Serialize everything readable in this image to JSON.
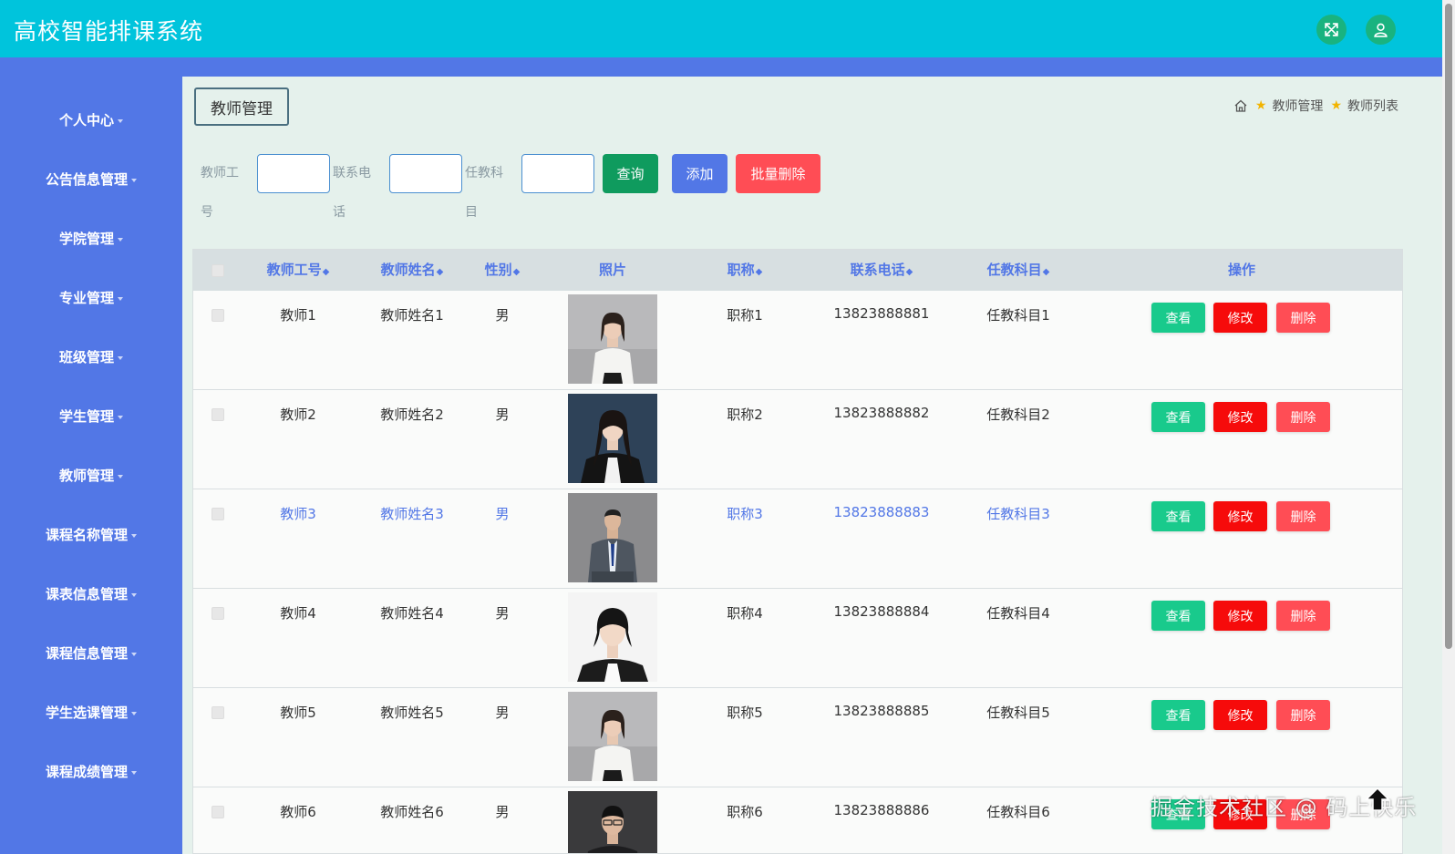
{
  "app": {
    "title": "高校智能排课系统"
  },
  "sidebar": {
    "items": [
      {
        "label": "个人中心"
      },
      {
        "label": "公告信息管理"
      },
      {
        "label": "学院管理"
      },
      {
        "label": "专业管理"
      },
      {
        "label": "班级管理"
      },
      {
        "label": "学生管理"
      },
      {
        "label": "教师管理"
      },
      {
        "label": "课程名称管理"
      },
      {
        "label": "课表信息管理"
      },
      {
        "label": "课程信息管理"
      },
      {
        "label": "学生选课管理"
      },
      {
        "label": "课程成绩管理"
      }
    ]
  },
  "page": {
    "title": "教师管理"
  },
  "breadcrumb": {
    "home_icon": "home-icon",
    "items": [
      "教师管理",
      "教师列表"
    ]
  },
  "search": {
    "fields": [
      {
        "label": "教师工号",
        "value": ""
      },
      {
        "label": "联系电话",
        "value": ""
      },
      {
        "label": "任教科目",
        "value": ""
      }
    ],
    "query_label": "查询",
    "add_label": "添加",
    "batch_delete_label": "批量删除"
  },
  "table": {
    "columns": [
      "教师工号",
      "教师姓名",
      "性别",
      "照片",
      "职称",
      "联系电话",
      "任教科目",
      "操作"
    ],
    "sort_icon": "◆",
    "actions": {
      "view": "查看",
      "edit": "修改",
      "delete": "删除"
    },
    "rows": [
      {
        "id": "教师1",
        "name": "教师姓名1",
        "gender": "男",
        "title": "职称1",
        "phone": "13823888881",
        "subject": "任教科目1",
        "highlighted": false
      },
      {
        "id": "教师2",
        "name": "教师姓名2",
        "gender": "男",
        "title": "职称2",
        "phone": "13823888882",
        "subject": "任教科目2",
        "highlighted": false
      },
      {
        "id": "教师3",
        "name": "教师姓名3",
        "gender": "男",
        "title": "职称3",
        "phone": "13823888883",
        "subject": "任教科目3",
        "highlighted": true
      },
      {
        "id": "教师4",
        "name": "教师姓名4",
        "gender": "男",
        "title": "职称4",
        "phone": "13823888884",
        "subject": "任教科目4",
        "highlighted": false
      },
      {
        "id": "教师5",
        "name": "教师姓名5",
        "gender": "男",
        "title": "职称5",
        "phone": "13823888885",
        "subject": "任教科目5",
        "highlighted": false
      },
      {
        "id": "教师6",
        "name": "教师姓名6",
        "gender": "男",
        "title": "职称6",
        "phone": "13823888886",
        "subject": "任教科目6",
        "highlighted": false
      }
    ]
  },
  "watermark": "掘金技术社区 @ 码上快乐",
  "colors": {
    "topbar": "#00c4dc",
    "sidebar": "#5277e6",
    "main_bg": "#e5f1ec",
    "query_btn": "#0f9b5e",
    "add_btn": "#5277e6",
    "batch_delete_btn": "#ff4d55",
    "view_btn": "#19ca8c",
    "edit_btn": "#f60b0b",
    "delete_btn": "#ff4d55"
  }
}
